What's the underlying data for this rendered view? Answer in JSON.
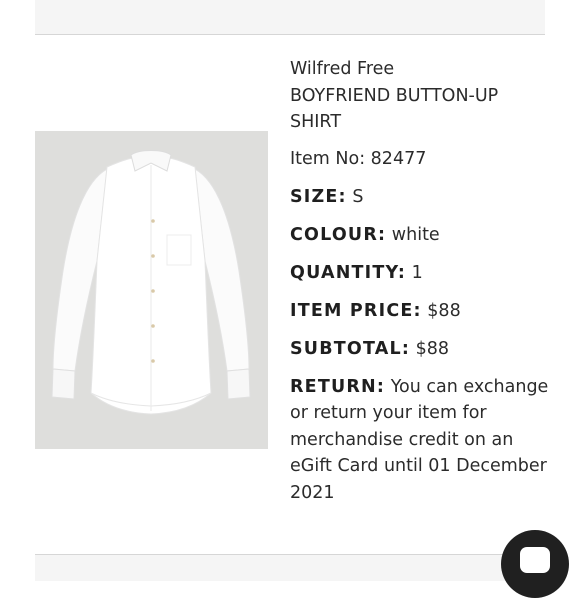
{
  "product": {
    "brand": "Wilfred Free",
    "name_line1": "BOYFRIEND BUTTON-UP",
    "name_line2": "SHIRT",
    "item_no_label": "Item No:",
    "item_no": "82477",
    "image_icon": "white-button-up-shirt"
  },
  "details": {
    "size_label": "SIZE:",
    "size": "S",
    "colour_label": "COLOUR:",
    "colour": "white",
    "quantity_label": "QUANTITY:",
    "quantity": "1",
    "item_price_label": "ITEM PRICE:",
    "item_price": "$88",
    "subtotal_label": "SUBTOTAL:",
    "subtotal": "$88",
    "return_label": "RETURN:",
    "return_text": "You can exchange or return your item for merchandise credit on an eGift Card until 01 December 2021"
  },
  "chat": {
    "icon": "chat-bubble-icon",
    "button_color": "#202020"
  }
}
